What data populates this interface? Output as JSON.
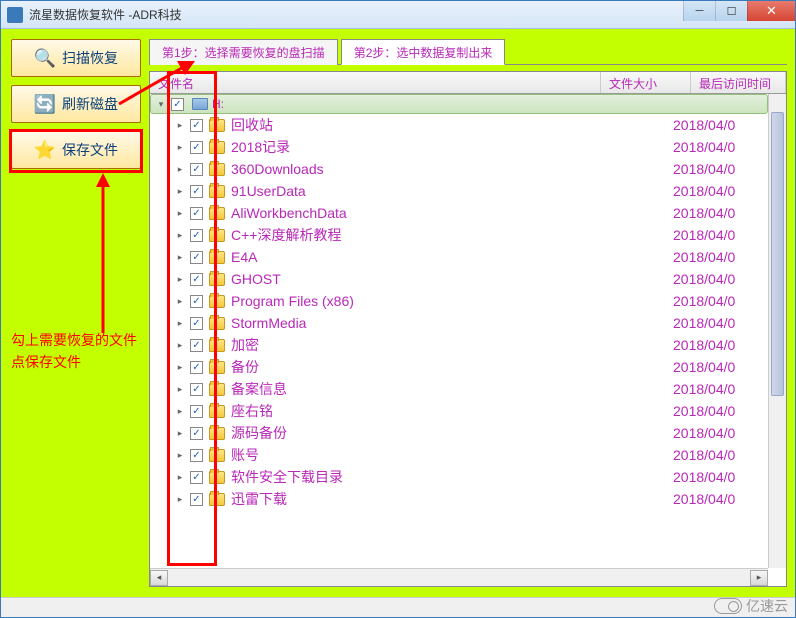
{
  "title": "流星数据恢复软件   -ADR科技",
  "sidebar": {
    "scan": "扫描恢复",
    "refresh": "刷新磁盘",
    "save": "保存文件"
  },
  "annotation": {
    "line1": "勾上需要恢复的文件",
    "line2": "点保存文件"
  },
  "tabs": {
    "t1": "第1步：选择需要恢复的盘扫描",
    "t2": "第2步：选中数据复制出来"
  },
  "columns": {
    "name": "文件名",
    "size": "文件大小",
    "date": "最后访问时间"
  },
  "drive": "H:",
  "folders": [
    {
      "name": "回收站",
      "date": "2018/04/0"
    },
    {
      "name": "2018记录",
      "date": "2018/04/0"
    },
    {
      "name": "360Downloads",
      "date": "2018/04/0"
    },
    {
      "name": "91UserData",
      "date": "2018/04/0"
    },
    {
      "name": "AliWorkbenchData",
      "date": "2018/04/0"
    },
    {
      "name": "C++深度解析教程",
      "date": "2018/04/0"
    },
    {
      "name": "E4A",
      "date": "2018/04/0"
    },
    {
      "name": "GHOST",
      "date": "2018/04/0"
    },
    {
      "name": "Program Files (x86)",
      "date": "2018/04/0"
    },
    {
      "name": "StormMedia",
      "date": "2018/04/0"
    },
    {
      "name": "加密",
      "date": "2018/04/0"
    },
    {
      "name": "备份",
      "date": "2018/04/0"
    },
    {
      "name": "备案信息",
      "date": "2018/04/0"
    },
    {
      "name": "座右铭",
      "date": "2018/04/0"
    },
    {
      "name": "源码备份",
      "date": "2018/04/0"
    },
    {
      "name": "账号",
      "date": "2018/04/0"
    },
    {
      "name": "软件安全下载目录",
      "date": "2018/04/0"
    },
    {
      "name": "迅雷下载",
      "date": "2018/04/0"
    }
  ],
  "watermark": "亿速云"
}
